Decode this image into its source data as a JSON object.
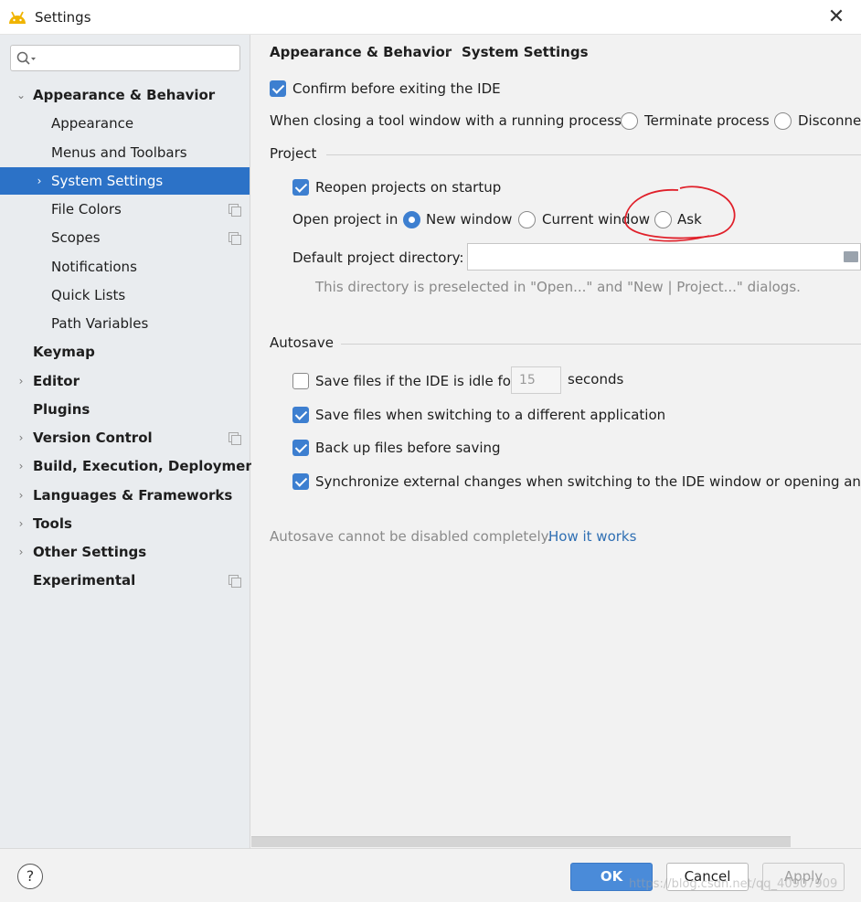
{
  "window": {
    "title": "Settings"
  },
  "sidebar": {
    "search_placeholder": "",
    "items": [
      {
        "label": "Appearance & Behavior",
        "level": 0,
        "expanded": true
      },
      {
        "label": "Appearance",
        "level": 1
      },
      {
        "label": "Menus and Toolbars",
        "level": 1
      },
      {
        "label": "System Settings",
        "level": 1,
        "selected": true
      },
      {
        "label": "File Colors",
        "level": 1
      },
      {
        "label": "Scopes",
        "level": 1
      },
      {
        "label": "Notifications",
        "level": 1
      },
      {
        "label": "Quick Lists",
        "level": 1
      },
      {
        "label": "Path Variables",
        "level": 1
      },
      {
        "label": "Keymap",
        "level": 0
      },
      {
        "label": "Editor",
        "level": 0
      },
      {
        "label": "Plugins",
        "level": 0
      },
      {
        "label": "Version Control",
        "level": 0
      },
      {
        "label": "Build, Execution, Deployment",
        "level": 0
      },
      {
        "label": "Languages & Frameworks",
        "level": 0
      },
      {
        "label": "Tools",
        "level": 0
      },
      {
        "label": "Other Settings",
        "level": 0
      },
      {
        "label": "Experimental",
        "level": 0
      }
    ]
  },
  "breadcrumb": {
    "parent": "Appearance & Behavior",
    "sep": "›",
    "current": "System Settings"
  },
  "general": {
    "confirm_exit": {
      "label": "Confirm before exiting the IDE",
      "checked": true
    },
    "closing_label": "When closing a tool window with a running process:",
    "closing_options": [
      "Terminate process",
      "Disconnect"
    ]
  },
  "project": {
    "title": "Project",
    "reopen": {
      "label": "Reopen projects on startup",
      "checked": true
    },
    "open_in_label": "Open project in",
    "open_in_options": [
      {
        "label": "New window",
        "selected": true
      },
      {
        "label": "Current window",
        "selected": false
      },
      {
        "label": "Ask",
        "selected": false
      }
    ],
    "default_dir_label": "Default project directory:",
    "default_dir_value": "",
    "default_dir_hint": "This directory is preselected in \"Open...\" and \"New | Project...\" dialogs."
  },
  "autosave": {
    "title": "Autosave",
    "idle": {
      "label": "Save files if the IDE is idle for",
      "checked": false,
      "value": "15",
      "unit": "seconds"
    },
    "switching": {
      "label": "Save files when switching to a different application",
      "checked": true
    },
    "backup": {
      "label": "Back up files before saving",
      "checked": true
    },
    "sync": {
      "label": "Synchronize external changes when switching to the IDE window or opening an editor",
      "checked": true
    },
    "note": "Autosave cannot be disabled completely.",
    "note_link": "How it works"
  },
  "buttons": {
    "help": "?",
    "ok": "OK",
    "cancel": "Cancel",
    "apply": "Apply"
  },
  "watermark": "https://blog.csdn.net/qq_40907909",
  "colors": {
    "accent": "#2c72c7",
    "link": "#2f6fb3",
    "annotation": "#e0202a"
  }
}
